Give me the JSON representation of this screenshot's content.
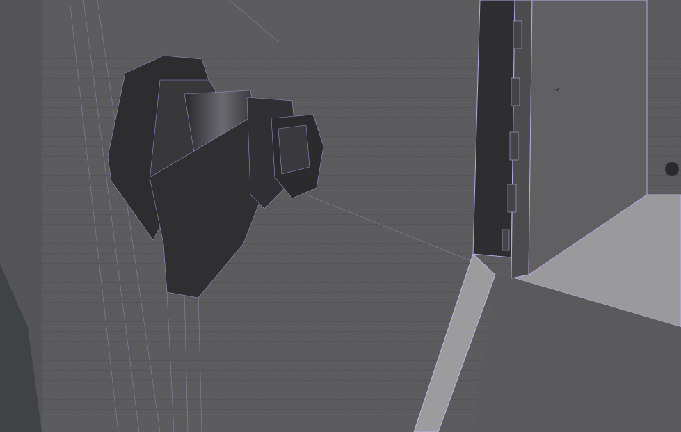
{
  "viewport": {
    "axis_label": "-z",
    "colors": {
      "background": "#5c5c5e",
      "grid": "#4a4a4c",
      "wireframe": "#b4a6e0",
      "mesh": "#2e2e31",
      "floor": "#9a9a9c"
    }
  }
}
